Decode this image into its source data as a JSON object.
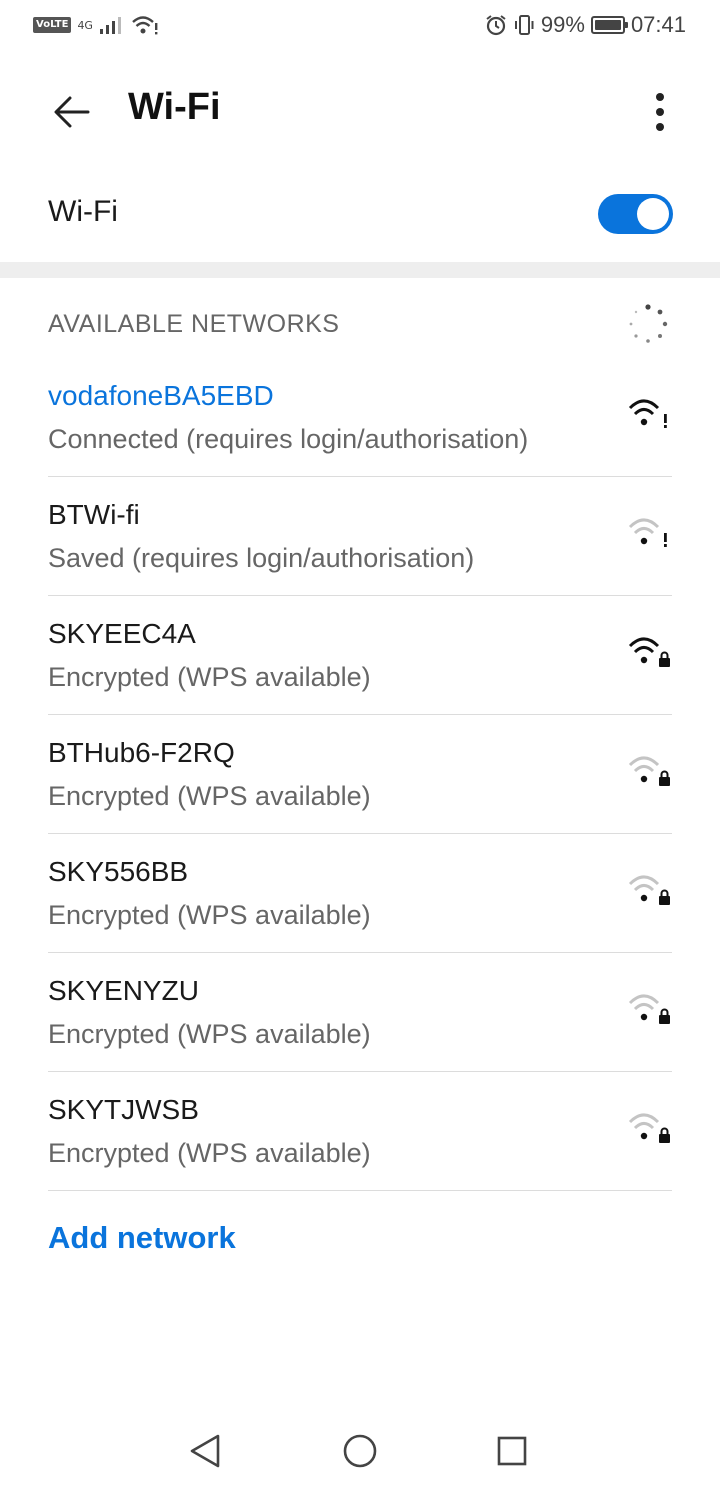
{
  "status_bar": {
    "volte": "VoLTE",
    "network_type": "4G",
    "battery_percent": "99%",
    "battery_level": 0.99,
    "time": "07:41",
    "icons": [
      "signal-icon",
      "wifi-alert-icon",
      "alarm-icon",
      "vibrate-icon",
      "battery-icon"
    ]
  },
  "header": {
    "title": "Wi-Fi",
    "back_icon": "back-arrow-icon",
    "more_icon": "more-vertical-icon"
  },
  "wifi_toggle": {
    "label": "Wi-Fi",
    "enabled": true
  },
  "section": {
    "title": "AVAILABLE NETWORKS",
    "scanning_icon": "loading-spinner-icon"
  },
  "networks": [
    {
      "ssid": "vodafoneBA5EBD",
      "status": "Connected (requires login/authorisation)",
      "connected": true,
      "icon": "wifi-alert-icon",
      "signal": "strong"
    },
    {
      "ssid": "BTWi-fi",
      "status": "Saved (requires login/authorisation)",
      "connected": false,
      "icon": "wifi-alert-icon",
      "signal": "weak"
    },
    {
      "ssid": "SKYEEC4A",
      "status": "Encrypted (WPS available)",
      "connected": false,
      "icon": "wifi-lock-icon",
      "signal": "strong"
    },
    {
      "ssid": "BTHub6-F2RQ",
      "status": "Encrypted (WPS available)",
      "connected": false,
      "icon": "wifi-lock-icon",
      "signal": "weak"
    },
    {
      "ssid": "SKY556BB",
      "status": "Encrypted (WPS available)",
      "connected": false,
      "icon": "wifi-lock-icon",
      "signal": "weak"
    },
    {
      "ssid": "SKYENYZU",
      "status": "Encrypted (WPS available)",
      "connected": false,
      "icon": "wifi-lock-icon",
      "signal": "weak"
    },
    {
      "ssid": "SKYTJWSB",
      "status": "Encrypted (WPS available)",
      "connected": false,
      "icon": "wifi-lock-icon",
      "signal": "weak"
    }
  ],
  "add_network": "Add network",
  "nav_bar": {
    "back_icon": "nav-back-icon",
    "home_icon": "nav-home-icon",
    "recents_icon": "nav-recents-icon"
  },
  "colors": {
    "accent": "#0a74dc",
    "text_primary": "#1a1a1a",
    "text_secondary": "#666666"
  }
}
